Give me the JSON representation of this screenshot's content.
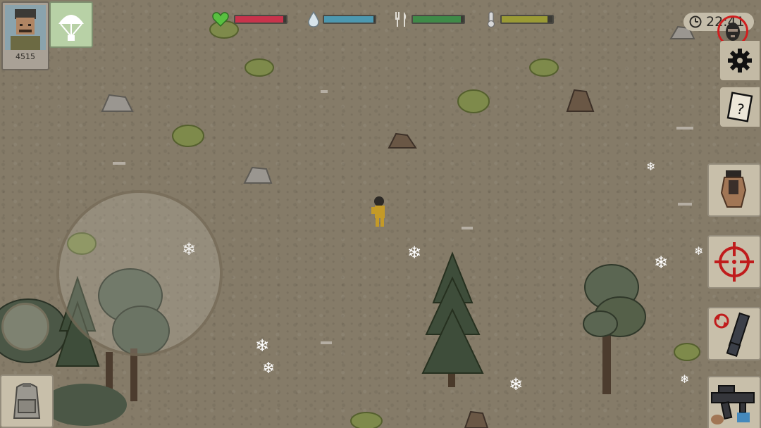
{
  "hud": {
    "player_score": "4515",
    "clock_time": "22:41",
    "stats": [
      {
        "name": "health",
        "icon": "heart-icon",
        "level": 0.95,
        "color": "#c8334b"
      },
      {
        "name": "thirst",
        "icon": "water-drop-icon",
        "level": 0.97,
        "color": "#4c98b0"
      },
      {
        "name": "hunger",
        "icon": "fork-knife-icon",
        "level": 0.95,
        "color": "#3f8a48"
      },
      {
        "name": "temperature",
        "icon": "thermometer-icon",
        "level": 0.9,
        "color": "#9a9a35"
      }
    ]
  },
  "buttons": {
    "stealth": "stealth-mask-icon",
    "settings": "gear-icon",
    "journal": "journal-icon",
    "melee": "fist-icon",
    "aim": "crosshair-icon",
    "reload": "reload-icon",
    "weapon": "rifle-icon",
    "inventory": "backpack-icon",
    "airdrop": "parachute-icon"
  },
  "colors": {
    "ground": "#857b68",
    "panel": "#c8bfaa",
    "crosshair": "#c01c1c"
  }
}
